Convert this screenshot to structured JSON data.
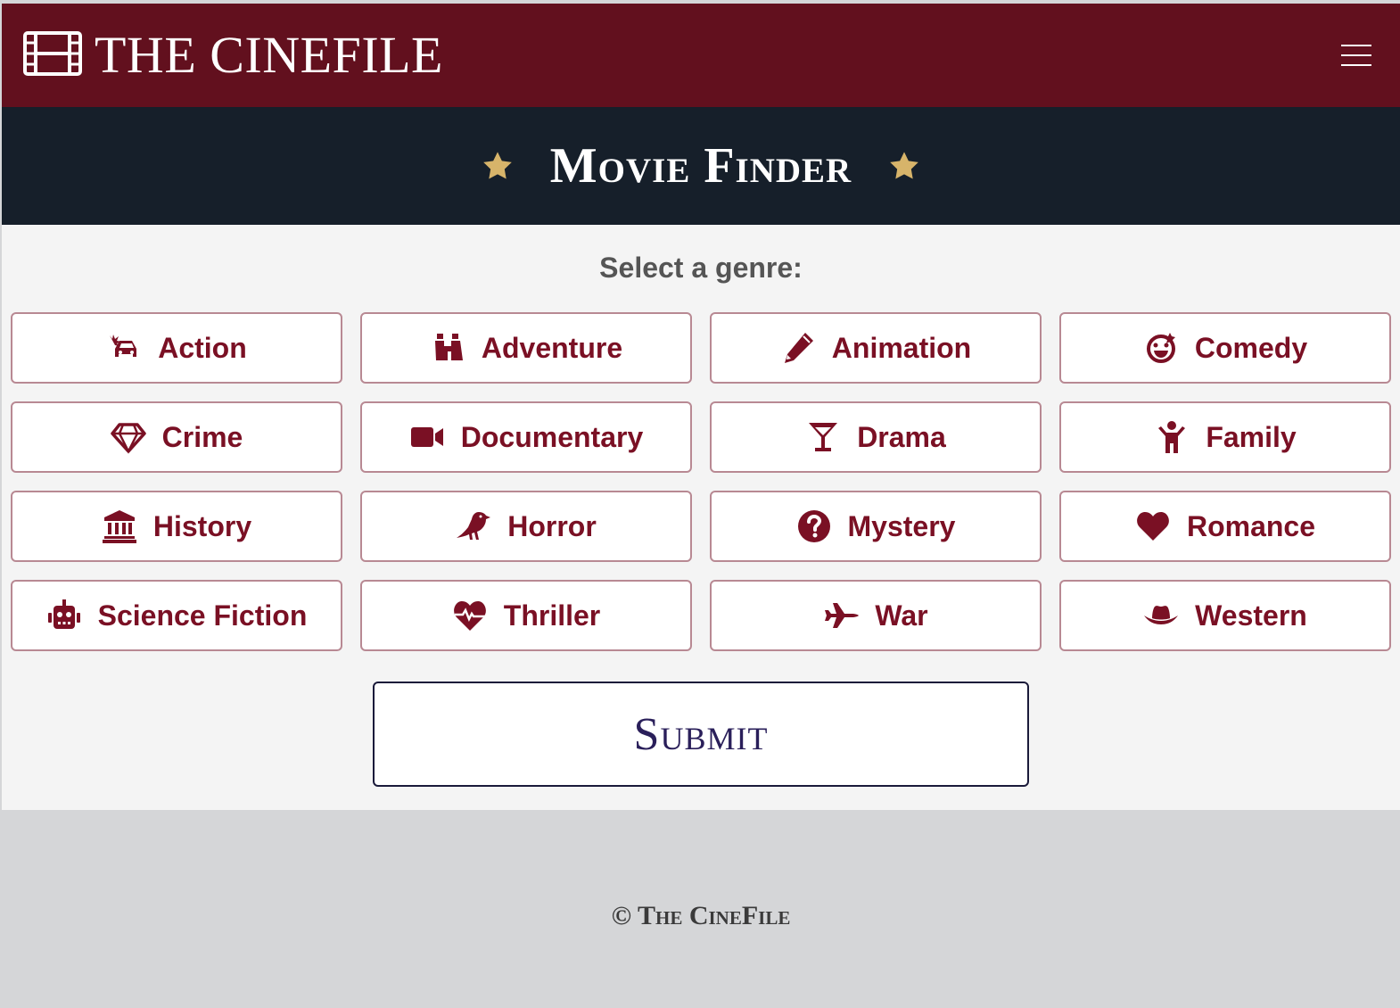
{
  "header": {
    "brand": "THE CINEFILE",
    "logo_icon": "film-icon",
    "menu_icon": "hamburger-menu-icon"
  },
  "banner": {
    "title": "Movie Finder",
    "star_color": "#d7b46a"
  },
  "main": {
    "prompt": "Select a genre:",
    "genres": [
      {
        "label": "Action",
        "icon": "car-crash-icon"
      },
      {
        "label": "Adventure",
        "icon": "binoculars-icon"
      },
      {
        "label": "Animation",
        "icon": "pencil-icon"
      },
      {
        "label": "Comedy",
        "icon": "laughing-face-icon"
      },
      {
        "label": "Crime",
        "icon": "gem-icon"
      },
      {
        "label": "Documentary",
        "icon": "video-camera-icon"
      },
      {
        "label": "Drama",
        "icon": "martini-glass-icon"
      },
      {
        "label": "Family",
        "icon": "child-icon"
      },
      {
        "label": "History",
        "icon": "landmark-icon"
      },
      {
        "label": "Horror",
        "icon": "crow-icon"
      },
      {
        "label": "Mystery",
        "icon": "question-circle-icon"
      },
      {
        "label": "Romance",
        "icon": "heart-icon"
      },
      {
        "label": "Science Fiction",
        "icon": "robot-icon"
      },
      {
        "label": "Thriller",
        "icon": "heart-pulse-icon"
      },
      {
        "label": "War",
        "icon": "fighter-jet-icon"
      },
      {
        "label": "Western",
        "icon": "cowboy-hat-icon"
      }
    ],
    "submit_label": "Submit"
  },
  "footer": {
    "text": "© The CineFile"
  },
  "colors": {
    "header_bg": "#62101e",
    "banner_bg": "#161f2a",
    "accent": "#7a1024",
    "submit_text": "#2a1f5a"
  }
}
